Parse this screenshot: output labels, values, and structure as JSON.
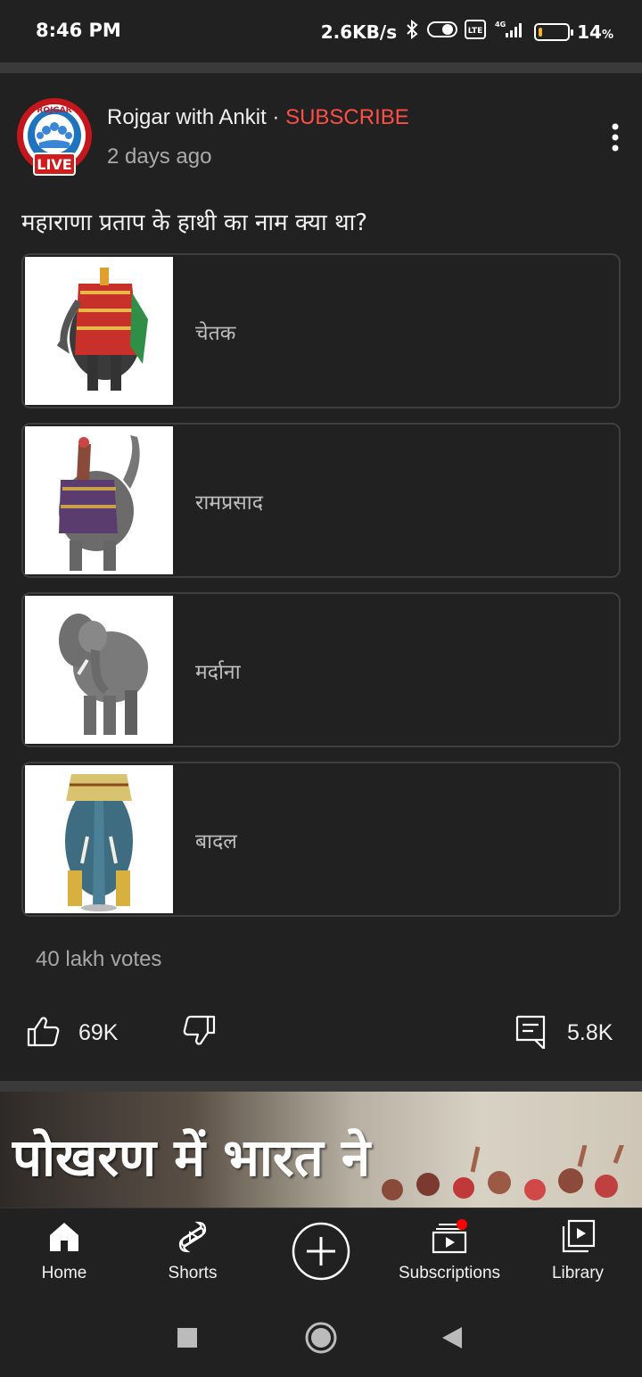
{
  "status_bar": {
    "time": "8:46 PM",
    "network_speed": "2.6KB/s",
    "network_type": "4G",
    "volte": "Vo LTE",
    "battery_percent": "14",
    "battery_unit": "%",
    "battery_level": 0.14,
    "battery_color": "#f0b23a"
  },
  "post": {
    "channel_name": "Rojgar with Ankit",
    "separator": " · ",
    "subscribe_label": "SUBSCRIBE",
    "subscribe_color": "#ff4e45",
    "time_ago": "2 days ago",
    "live_badge": "LIVE",
    "avatar_text": "ROJGAR",
    "question": "महाराणा प्रताप के हाथी का नाम क्या था?",
    "options": [
      {
        "label": "चेतक",
        "image": "decorated-elephant-red"
      },
      {
        "label": "रामप्रसाद",
        "image": "war-elephant-armored"
      },
      {
        "label": "मर्दाना",
        "image": "grey-elephant"
      },
      {
        "label": "बादल",
        "image": "painted-elephant-blue"
      }
    ],
    "votes": "40 lakh votes",
    "like_count": "69K",
    "comment_count": "5.8K"
  },
  "thumbnail": {
    "title": "पोखरण में भारत ने"
  },
  "bottom_nav": {
    "items": [
      {
        "label": "Home",
        "icon": "home-icon"
      },
      {
        "label": "Shorts",
        "icon": "shorts-icon"
      },
      {
        "label": "",
        "icon": "create-icon"
      },
      {
        "label": "Subscriptions",
        "icon": "subscriptions-icon"
      },
      {
        "label": "Library",
        "icon": "library-icon"
      }
    ]
  }
}
